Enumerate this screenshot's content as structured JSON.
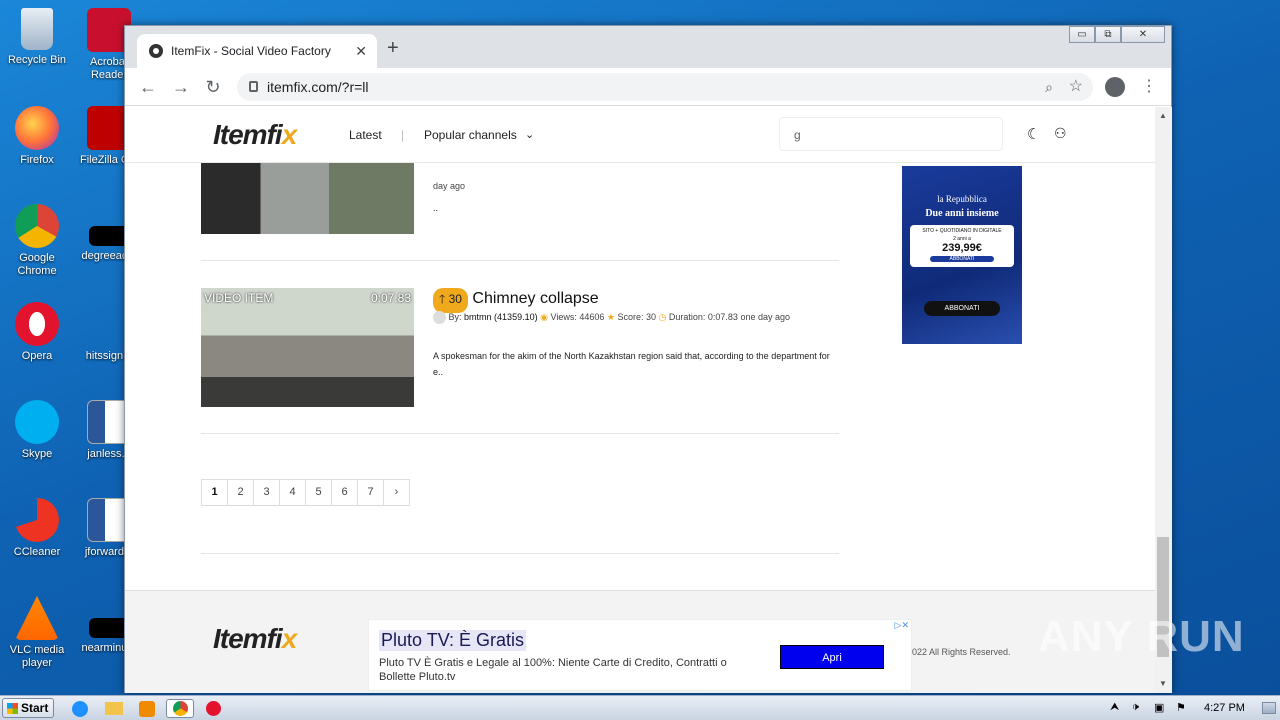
{
  "desktop": {
    "icons": [
      {
        "label": "Recycle Bin",
        "icon": "recycle-bin-icon"
      },
      {
        "label": "Acrobat Reader",
        "icon": "acrobat-icon"
      },
      {
        "label": "Firefox",
        "icon": "firefox-icon"
      },
      {
        "label": "FileZilla C...",
        "icon": "filezilla-icon"
      },
      {
        "label": "Google Chrome",
        "icon": "chrome-icon"
      },
      {
        "label": "degreeac...",
        "icon": "file-icon"
      },
      {
        "label": "Opera",
        "icon": "opera-icon"
      },
      {
        "label": "hitssign...",
        "icon": "file-icon"
      },
      {
        "label": "Skype",
        "icon": "skype-icon"
      },
      {
        "label": "janless...",
        "icon": "word-icon"
      },
      {
        "label": "CCleaner",
        "icon": "ccleaner-icon"
      },
      {
        "label": "jforward...",
        "icon": "word-icon"
      },
      {
        "label": "VLC media player",
        "icon": "vlc-icon"
      },
      {
        "label": "nearminu...",
        "icon": "file-icon"
      }
    ]
  },
  "browser": {
    "tab_title": "ItemFix - Social Video Factory",
    "url": "itemfix.com/?r=ll",
    "new_tab": "+",
    "window_buttons": [
      "▭",
      "⧉",
      "✕"
    ]
  },
  "site": {
    "logo_main": "Itemfi",
    "logo_accent": "x",
    "nav": {
      "latest": "Latest",
      "separator": "|",
      "popular": "Popular channels"
    },
    "search_value": "g"
  },
  "items": [
    {
      "meta_tail": "day ago",
      "desc": ".."
    },
    {
      "badge": "VIDEO ITEM",
      "duration_badge": "0:07.83",
      "score": "30",
      "title": "Chimney collapse",
      "by_label": "By:",
      "author": "bmtmn (41359.10)",
      "views": "Views: 44606",
      "score_text": "Score: 30",
      "duration": "Duration: 0:07.83",
      "age": "one day ago",
      "desc": "A spokesman for the akim of the North Kazakhstan region said that, according to the department for e.."
    }
  ],
  "pagination": [
    "1",
    "2",
    "3",
    "4",
    "5",
    "6",
    "7",
    "›"
  ],
  "ad_right": {
    "brand": "la Repubblica",
    "headline": "Due anni insieme",
    "sub": "SITO + QUOTIDIANO IN DIGITALE",
    "price_label": "2 anni a",
    "price": "239,99€",
    "cta": "ABBONATI",
    "cta2": "ABBONATI"
  },
  "banner_ad": {
    "title": "Pluto TV: È Gratis",
    "body": "Pluto TV È Gratis e Legale al 100%: Niente Carte di Credito, Contratti o Bollette Pluto.tv",
    "cta": "Apri"
  },
  "footer": {
    "copyright": "022 All Rights Reserved."
  },
  "watermark": "ANY RUN",
  "taskbar": {
    "start": "Start",
    "clock": "4:27 PM"
  }
}
